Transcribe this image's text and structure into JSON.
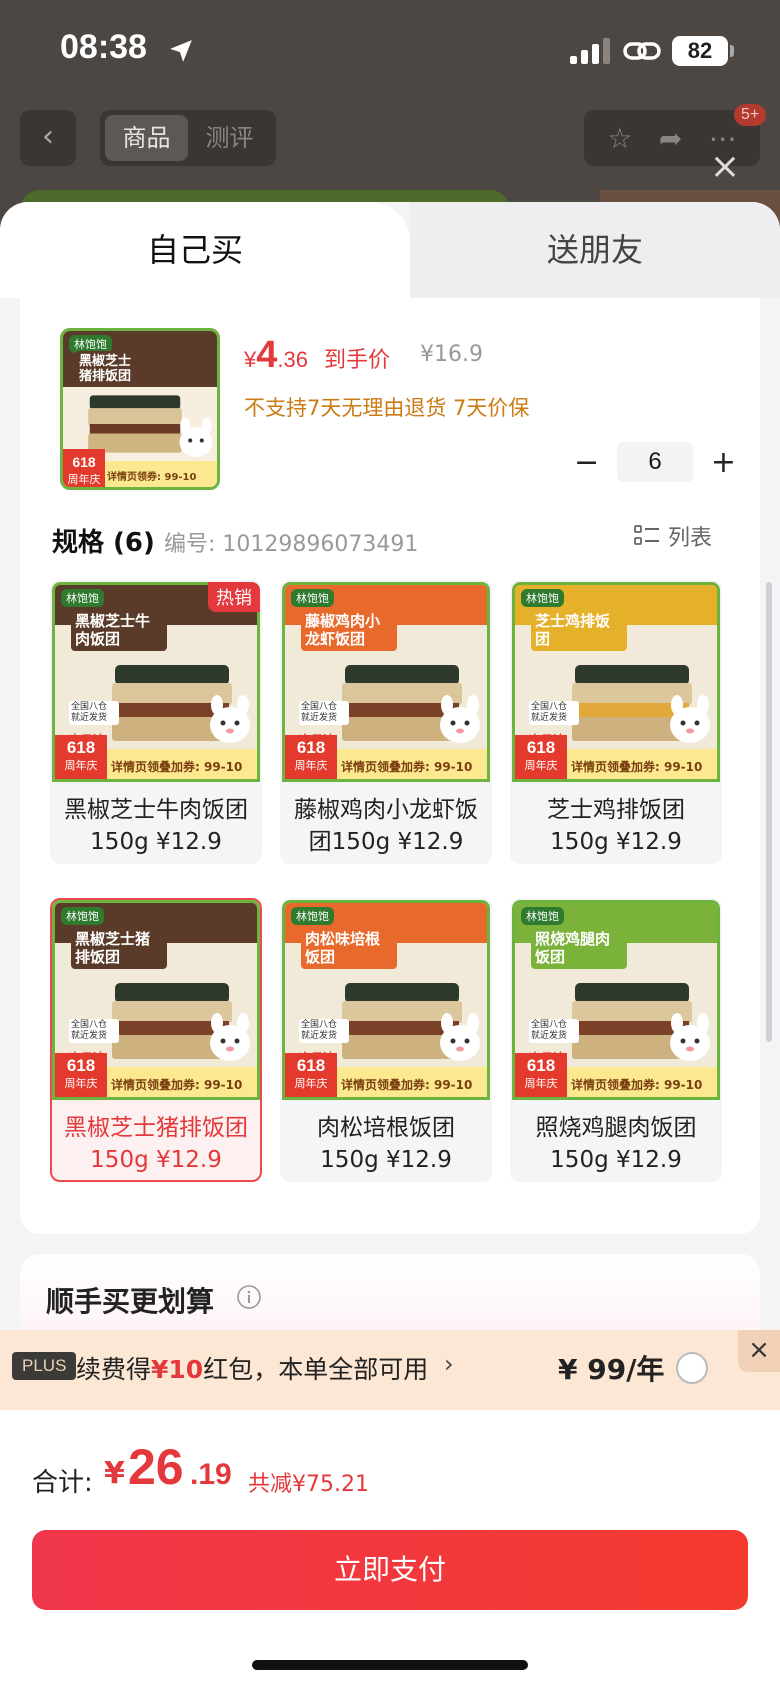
{
  "status_bar": {
    "time": "08:38",
    "battery": "82"
  },
  "nav": {
    "tabs": [
      "商品",
      "测评"
    ],
    "badge": "5+"
  },
  "sheet": {
    "tabs": {
      "left": "自己买",
      "right": "送朋友"
    }
  },
  "product": {
    "price_yen": "¥",
    "price_int": "4",
    "price_dec": ".36",
    "price_label": "到手价",
    "orig_price": "¥16.9",
    "policy": "不支持7天无理由退货  7天价保",
    "quantity": "6",
    "thumb_title": "黑椒芝士猪排饭团",
    "thumb_coupon": "详情页领券: 99-10"
  },
  "spec": {
    "title": "规格 (6)",
    "code_label": "编号: 10129896073491",
    "list_label": "列表"
  },
  "skus": [
    {
      "name": "黑椒芝士牛肉饭团150g ¥12.9",
      "img_title": "黑椒芝士牛肉饭团",
      "tag": "热销",
      "band": "#5a3b2a",
      "selected": false
    },
    {
      "name": "藤椒鸡肉小龙虾饭团150g ¥12.9",
      "img_title": "藤椒鸡肉小龙虾饭团",
      "tag": "",
      "band": "#e8692c",
      "selected": false
    },
    {
      "name": "芝士鸡排饭团150g ¥12.9",
      "img_title": "芝士鸡排饭团",
      "tag": "",
      "band": "#e6b12a",
      "selected": false
    },
    {
      "name": "黑椒芝士猪排饭团150g ¥12.9",
      "img_title": "黑椒芝士猪排饭团",
      "tag": "",
      "band": "#5a3b2a",
      "selected": true
    },
    {
      "name": "肉松培根饭团150g ¥12.9",
      "img_title": "肉松味培根饭团",
      "tag": "",
      "band": "#e8692c",
      "selected": false
    },
    {
      "name": "照烧鸡腿肉饭团150g ¥12.9",
      "img_title": "照烧鸡腿肉饭团",
      "tag": "",
      "band": "#7bb23a",
      "selected": false
    }
  ],
  "sku_image_common": {
    "brand": "林饱饱",
    "badge_618": "618",
    "badge_sub": "周年庆",
    "coupon": "详情页领叠加券: 99-10",
    "warehouse": "全国八仓 就近发货",
    "next_day": "次日达"
  },
  "upsell": {
    "title": "顺手买更划算"
  },
  "plus": {
    "badge": "PLUS",
    "text_pre": "续费得",
    "text_hl": "¥10",
    "text_post": "红包，本单全部可用",
    "price": "¥ 99/年"
  },
  "footer": {
    "total_label": "合计:",
    "total_yen": "¥",
    "total_int": "26",
    "total_dec": ".19",
    "saved": "共减¥75.21",
    "pay_label": "立即支付"
  },
  "colors": {
    "accent": "#e4393c",
    "plus_bg": "#fbe7d3",
    "brand_green": "#6cb33f"
  }
}
